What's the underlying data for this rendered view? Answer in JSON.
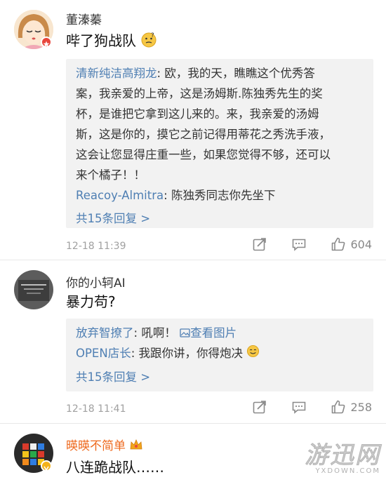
{
  "comments": [
    {
      "username": "董溱蓁",
      "text": "哔了狗战队",
      "replies": [
        {
          "name": "清新纯洁高翔龙",
          "sep": ": ",
          "text": "欧，我的天，瞧瞧这个优秀答",
          "cont": [
            "案，我亲爱的上帝，这是汤姆斯.陈独秀先生的奖",
            "杯，是谁把它拿到这儿来的。来，我亲爱的汤姆",
            "斯，这是你的，摸它之前记得用蒂花之秀洗手液，",
            "这会让您显得庄重一些，如果您觉得不够，还可以",
            "来个橘子！！"
          ]
        },
        {
          "name": "Reacoy-Almitra",
          "sep": ": ",
          "text": "陈独秀同志你先坐下",
          "cont": []
        }
      ],
      "more": "共15条回复 >",
      "time": "12-18 11:39",
      "likes": "604"
    },
    {
      "username": "你的小轲AI",
      "text": "暴力苟?",
      "replies": [
        {
          "name": "放弃智撩了",
          "sep": ": ",
          "text": "吼啊！",
          "link": "查看图片"
        },
        {
          "name": "OPEN店长",
          "sep": ": ",
          "text": "我跟你讲，你得炮决",
          "cont": []
        }
      ],
      "more": "共15条回复 >",
      "time": "12-18 11:41",
      "likes": "258"
    },
    {
      "username": "暎暎不简单",
      "text": "八连跪战队……"
    }
  ],
  "watermark": {
    "main": "游迅网",
    "sub": "YXDOWN.COM"
  },
  "colors": {
    "link": "#4f7fb3",
    "vip_name": "#ee6a1f",
    "reply_bg": "#f2f2f2"
  },
  "icons": [
    "repost-icon",
    "comment-icon",
    "like-icon"
  ]
}
